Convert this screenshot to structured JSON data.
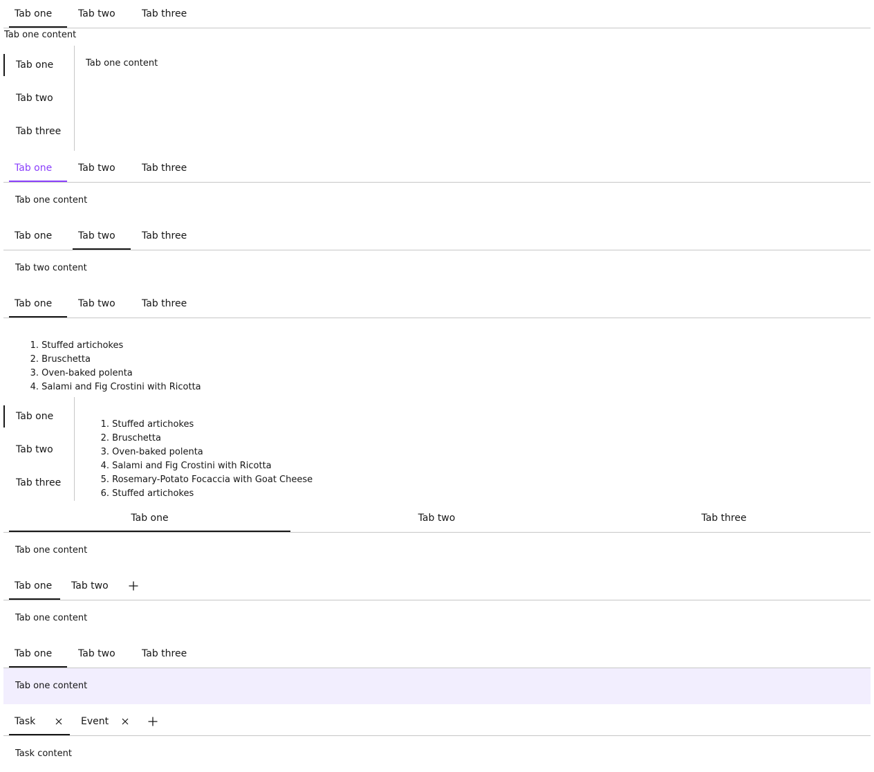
{
  "tabs_basic": {
    "tabs": [
      "Tab one",
      "Tab two",
      "Tab three"
    ],
    "content": "Tab one content"
  },
  "tabs_vertical": {
    "tabs": [
      "Tab one",
      "Tab two",
      "Tab three"
    ],
    "content": "Tab one content"
  },
  "tabs_accent": {
    "tabs": [
      "Tab one",
      "Tab two",
      "Tab three"
    ],
    "content": "Tab one content",
    "accent_color": "#8a3ffc"
  },
  "tabs_second_selected": {
    "tabs": [
      "Tab one",
      "Tab two",
      "Tab three"
    ],
    "content": "Tab two content"
  },
  "tabs_list": {
    "tabs": [
      "Tab one",
      "Tab two",
      "Tab three"
    ],
    "items": [
      "Stuffed artichokes",
      "Bruschetta",
      "Oven-baked polenta",
      "Salami and Fig Crostini with Ricotta"
    ]
  },
  "tabs_vertical_list": {
    "tabs": [
      "Tab one",
      "Tab two",
      "Tab three"
    ],
    "items": [
      "Stuffed artichokes",
      "Bruschetta",
      "Oven-baked polenta",
      "Salami and Fig Crostini with Ricotta",
      "Rosemary-Potato Focaccia with Goat Cheese",
      "Stuffed artichokes"
    ]
  },
  "tabs_fullwidth": {
    "tabs": [
      "Tab one",
      "Tab two",
      "Tab three"
    ],
    "content": "Tab one content"
  },
  "tabs_addable": {
    "tabs": [
      "Tab one",
      "Tab two"
    ],
    "add_icon": "plus-icon",
    "content": "Tab one content"
  },
  "tabs_contained": {
    "tabs": [
      "Tab one",
      "Tab two",
      "Tab three"
    ],
    "content": "Tab one content",
    "panel_color": "#f2eefe"
  },
  "tabs_dismissible": {
    "tabs": [
      "Task",
      "Event"
    ],
    "close_icon": "close-icon",
    "add_icon": "plus-icon",
    "content": "Task content"
  }
}
